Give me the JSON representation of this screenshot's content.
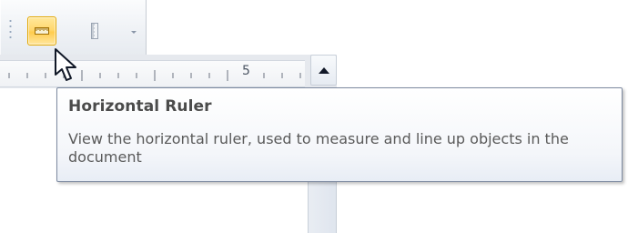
{
  "toolbar": {
    "buttons": [
      {
        "name": "horizontal-ruler",
        "icon": "horizontal-ruler-icon",
        "state": "active"
      },
      {
        "name": "vertical-ruler",
        "icon": "vertical-ruler-icon",
        "state": "normal"
      }
    ],
    "dropdown_icon": "chevron-down-icon"
  },
  "ruler": {
    "label": "5"
  },
  "tooltip": {
    "title": "Horizontal Ruler",
    "body": "View the horizontal ruler, used to measure and line up objects in the document"
  },
  "colors": {
    "active_button": "#ffd86f",
    "active_border": "#e2a700",
    "tooltip_border": "#7d8aa0"
  }
}
